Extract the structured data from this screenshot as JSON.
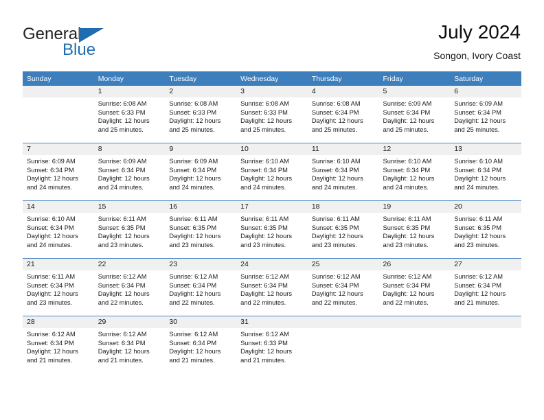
{
  "brand": {
    "name_part1": "General",
    "name_part2": "Blue",
    "accent_color": "#1f6cb0",
    "triangle_icon": "triangle-icon"
  },
  "header": {
    "month_title": "July 2024",
    "location": "Songon, Ivory Coast"
  },
  "calendar": {
    "header_bg": "#3d7ebd",
    "daynum_bg": "#f0f0f0",
    "weekday_headers": [
      "Sunday",
      "Monday",
      "Tuesday",
      "Wednesday",
      "Thursday",
      "Friday",
      "Saturday"
    ],
    "weeks": [
      [
        {
          "day": "",
          "lines": []
        },
        {
          "day": "1",
          "lines": [
            "Sunrise: 6:08 AM",
            "Sunset: 6:33 PM",
            "Daylight: 12 hours",
            "and 25 minutes."
          ]
        },
        {
          "day": "2",
          "lines": [
            "Sunrise: 6:08 AM",
            "Sunset: 6:33 PM",
            "Daylight: 12 hours",
            "and 25 minutes."
          ]
        },
        {
          "day": "3",
          "lines": [
            "Sunrise: 6:08 AM",
            "Sunset: 6:33 PM",
            "Daylight: 12 hours",
            "and 25 minutes."
          ]
        },
        {
          "day": "4",
          "lines": [
            "Sunrise: 6:08 AM",
            "Sunset: 6:34 PM",
            "Daylight: 12 hours",
            "and 25 minutes."
          ]
        },
        {
          "day": "5",
          "lines": [
            "Sunrise: 6:09 AM",
            "Sunset: 6:34 PM",
            "Daylight: 12 hours",
            "and 25 minutes."
          ]
        },
        {
          "day": "6",
          "lines": [
            "Sunrise: 6:09 AM",
            "Sunset: 6:34 PM",
            "Daylight: 12 hours",
            "and 25 minutes."
          ]
        }
      ],
      [
        {
          "day": "7",
          "lines": [
            "Sunrise: 6:09 AM",
            "Sunset: 6:34 PM",
            "Daylight: 12 hours",
            "and 24 minutes."
          ]
        },
        {
          "day": "8",
          "lines": [
            "Sunrise: 6:09 AM",
            "Sunset: 6:34 PM",
            "Daylight: 12 hours",
            "and 24 minutes."
          ]
        },
        {
          "day": "9",
          "lines": [
            "Sunrise: 6:09 AM",
            "Sunset: 6:34 PM",
            "Daylight: 12 hours",
            "and 24 minutes."
          ]
        },
        {
          "day": "10",
          "lines": [
            "Sunrise: 6:10 AM",
            "Sunset: 6:34 PM",
            "Daylight: 12 hours",
            "and 24 minutes."
          ]
        },
        {
          "day": "11",
          "lines": [
            "Sunrise: 6:10 AM",
            "Sunset: 6:34 PM",
            "Daylight: 12 hours",
            "and 24 minutes."
          ]
        },
        {
          "day": "12",
          "lines": [
            "Sunrise: 6:10 AM",
            "Sunset: 6:34 PM",
            "Daylight: 12 hours",
            "and 24 minutes."
          ]
        },
        {
          "day": "13",
          "lines": [
            "Sunrise: 6:10 AM",
            "Sunset: 6:34 PM",
            "Daylight: 12 hours",
            "and 24 minutes."
          ]
        }
      ],
      [
        {
          "day": "14",
          "lines": [
            "Sunrise: 6:10 AM",
            "Sunset: 6:34 PM",
            "Daylight: 12 hours",
            "and 24 minutes."
          ]
        },
        {
          "day": "15",
          "lines": [
            "Sunrise: 6:11 AM",
            "Sunset: 6:35 PM",
            "Daylight: 12 hours",
            "and 23 minutes."
          ]
        },
        {
          "day": "16",
          "lines": [
            "Sunrise: 6:11 AM",
            "Sunset: 6:35 PM",
            "Daylight: 12 hours",
            "and 23 minutes."
          ]
        },
        {
          "day": "17",
          "lines": [
            "Sunrise: 6:11 AM",
            "Sunset: 6:35 PM",
            "Daylight: 12 hours",
            "and 23 minutes."
          ]
        },
        {
          "day": "18",
          "lines": [
            "Sunrise: 6:11 AM",
            "Sunset: 6:35 PM",
            "Daylight: 12 hours",
            "and 23 minutes."
          ]
        },
        {
          "day": "19",
          "lines": [
            "Sunrise: 6:11 AM",
            "Sunset: 6:35 PM",
            "Daylight: 12 hours",
            "and 23 minutes."
          ]
        },
        {
          "day": "20",
          "lines": [
            "Sunrise: 6:11 AM",
            "Sunset: 6:35 PM",
            "Daylight: 12 hours",
            "and 23 minutes."
          ]
        }
      ],
      [
        {
          "day": "21",
          "lines": [
            "Sunrise: 6:11 AM",
            "Sunset: 6:34 PM",
            "Daylight: 12 hours",
            "and 23 minutes."
          ]
        },
        {
          "day": "22",
          "lines": [
            "Sunrise: 6:12 AM",
            "Sunset: 6:34 PM",
            "Daylight: 12 hours",
            "and 22 minutes."
          ]
        },
        {
          "day": "23",
          "lines": [
            "Sunrise: 6:12 AM",
            "Sunset: 6:34 PM",
            "Daylight: 12 hours",
            "and 22 minutes."
          ]
        },
        {
          "day": "24",
          "lines": [
            "Sunrise: 6:12 AM",
            "Sunset: 6:34 PM",
            "Daylight: 12 hours",
            "and 22 minutes."
          ]
        },
        {
          "day": "25",
          "lines": [
            "Sunrise: 6:12 AM",
            "Sunset: 6:34 PM",
            "Daylight: 12 hours",
            "and 22 minutes."
          ]
        },
        {
          "day": "26",
          "lines": [
            "Sunrise: 6:12 AM",
            "Sunset: 6:34 PM",
            "Daylight: 12 hours",
            "and 22 minutes."
          ]
        },
        {
          "day": "27",
          "lines": [
            "Sunrise: 6:12 AM",
            "Sunset: 6:34 PM",
            "Daylight: 12 hours",
            "and 21 minutes."
          ]
        }
      ],
      [
        {
          "day": "28",
          "lines": [
            "Sunrise: 6:12 AM",
            "Sunset: 6:34 PM",
            "Daylight: 12 hours",
            "and 21 minutes."
          ]
        },
        {
          "day": "29",
          "lines": [
            "Sunrise: 6:12 AM",
            "Sunset: 6:34 PM",
            "Daylight: 12 hours",
            "and 21 minutes."
          ]
        },
        {
          "day": "30",
          "lines": [
            "Sunrise: 6:12 AM",
            "Sunset: 6:34 PM",
            "Daylight: 12 hours",
            "and 21 minutes."
          ]
        },
        {
          "day": "31",
          "lines": [
            "Sunrise: 6:12 AM",
            "Sunset: 6:33 PM",
            "Daylight: 12 hours",
            "and 21 minutes."
          ]
        },
        {
          "day": "",
          "lines": []
        },
        {
          "day": "",
          "lines": []
        },
        {
          "day": "",
          "lines": []
        }
      ]
    ]
  }
}
